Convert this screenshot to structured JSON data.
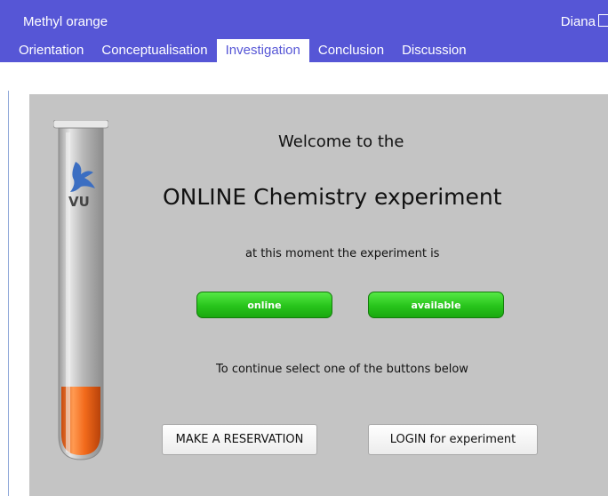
{
  "app": {
    "title": "Methyl orange",
    "user": "Diana",
    "user_icon": "external-link-icon",
    "accent_color": "#5656d6"
  },
  "tabs": [
    {
      "label": "Orientation",
      "active": false
    },
    {
      "label": "Conceptualisation",
      "active": false
    },
    {
      "label": "Investigation",
      "active": true
    },
    {
      "label": "Conclusion",
      "active": false
    },
    {
      "label": "Discussion",
      "active": false
    }
  ],
  "experiment": {
    "logo_text": "VU",
    "logo_icon": "griffin-icon",
    "welcome": "Welcome to the",
    "headline": "ONLINE Chemistry experiment",
    "status_text": "at this moment the experiment is",
    "status_badges": [
      {
        "label": "online",
        "color": "#27c41b"
      },
      {
        "label": "available",
        "color": "#27c41b"
      }
    ],
    "continue_text": "To continue select one of the buttons below",
    "buttons": {
      "reserve": "MAKE A RESERVATION",
      "login": "LOGIN for experiment"
    },
    "liquid_color": "#f26a1b"
  }
}
